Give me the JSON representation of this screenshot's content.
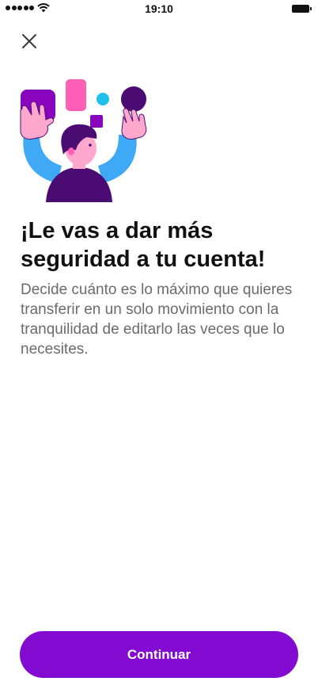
{
  "status_bar": {
    "time": "19:10",
    "icons": [
      "signal-icon",
      "wifi-icon",
      "battery-icon"
    ]
  },
  "header": {
    "close_icon": "close-icon"
  },
  "main": {
    "illustration": "person-juggling-shapes-illustration",
    "title": "¡Le vas a dar más seguridad a tu cuenta!",
    "description": "Decide cuánto es lo máximo que quieres transferir en un solo movimiento con la tranquilidad de editarlo las veces que lo necesites."
  },
  "footer": {
    "continue_label": "Continuar"
  },
  "colors": {
    "accent": "#820ad1",
    "title": "#111111",
    "body_text": "#6b6b6b",
    "illustration_purple": "#8a05be",
    "illustration_dark": "#4a0b73",
    "illustration_pink": "#ff5fb4",
    "illustration_blue": "#3fa9f5",
    "illustration_cyan": "#1fc1ec",
    "background": "#ffffff"
  }
}
